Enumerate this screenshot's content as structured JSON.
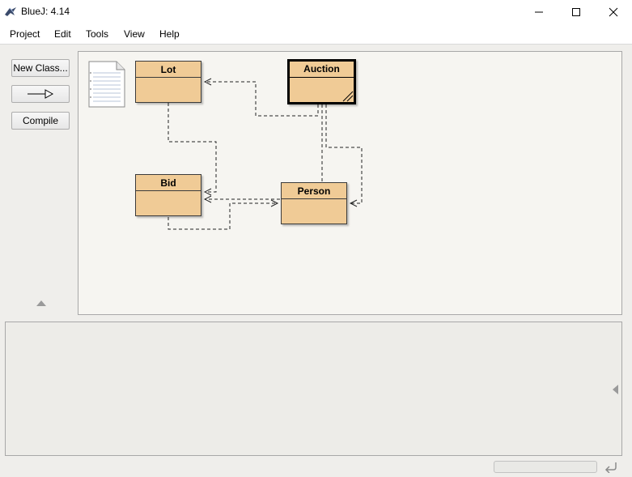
{
  "window": {
    "title": "BlueJ:  4.14"
  },
  "menu": {
    "items": [
      "Project",
      "Edit",
      "Tools",
      "View",
      "Help"
    ]
  },
  "toolbar": {
    "new_class_label": "New Class...",
    "compile_label": "Compile"
  },
  "diagram": {
    "classes": [
      {
        "name": "Lot",
        "selected": false
      },
      {
        "name": "Auction",
        "selected": true
      },
      {
        "name": "Bid",
        "selected": false
      },
      {
        "name": "Person",
        "selected": false
      }
    ]
  },
  "colors": {
    "class_fill": "#f0cb96",
    "canvas_bg": "#f6f5f1",
    "panel_bg": "#efeeeb"
  },
  "icons": {
    "app": "bluej-bird-icon",
    "minimize": "minimize-icon",
    "maximize": "maximize-icon",
    "close": "close-icon",
    "readme": "readme-document-icon",
    "inheritance_arrow": "inheritance-arrow-icon",
    "collapse_up": "triangle-up-icon",
    "expand_left": "triangle-left-icon",
    "reset": "reset-machine-icon"
  }
}
